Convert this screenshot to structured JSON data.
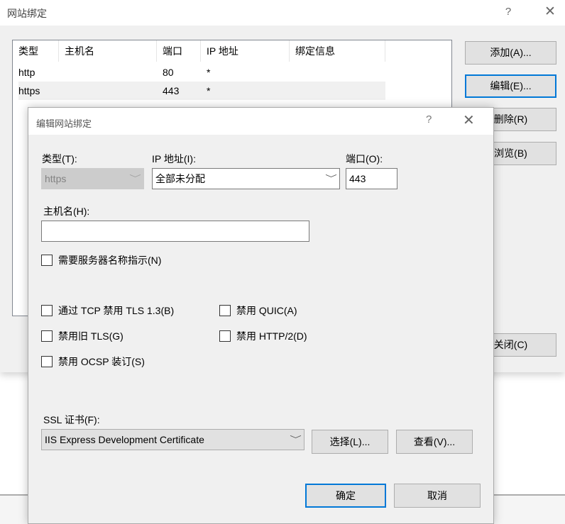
{
  "parent_window": {
    "title": "网站绑定",
    "help_glyph": "?",
    "close_glyph": "✕",
    "list": {
      "columns": [
        "类型",
        "主机名",
        "端口",
        "IP 地址",
        "绑定信息"
      ],
      "rows": [
        {
          "type": "http",
          "host": "",
          "port": "80",
          "ip": "*",
          "info": ""
        },
        {
          "type": "https",
          "host": "",
          "port": "443",
          "ip": "*",
          "info": ""
        }
      ],
      "selected_row": 1
    },
    "buttons": {
      "add": "添加(A)...",
      "edit": "编辑(E)...",
      "remove": "删除(R)",
      "browse": "浏览(B)",
      "close": "关闭(C)"
    }
  },
  "dialog": {
    "title": "编辑网站绑定",
    "help_glyph": "?",
    "close_glyph": "✕",
    "type_label": "类型(T):",
    "type_value": "https",
    "ip_label": "IP 地址(I):",
    "ip_value": "全部未分配",
    "port_label": "端口(O):",
    "port_value": "443",
    "host_label": "主机名(H):",
    "host_value": "",
    "checkboxes": {
      "sni": {
        "label": "需要服务器名称指示(N)",
        "checked": false
      },
      "disable_tls13_tcp": {
        "label": "通过 TCP 禁用 TLS 1.3(B)",
        "checked": false
      },
      "disable_quic": {
        "label": "禁用 QUIC(A)",
        "checked": false
      },
      "disable_legacy_tls": {
        "label": "禁用旧 TLS(G)",
        "checked": false
      },
      "disable_http2": {
        "label": "禁用 HTTP/2(D)",
        "checked": false
      },
      "disable_ocsp": {
        "label": "禁用 OCSP 装订(S)",
        "checked": false
      }
    },
    "ssl_label": "SSL 证书(F):",
    "ssl_value": "IIS Express Development Certificate",
    "select_button": "选择(L)...",
    "view_button": "查看(V)...",
    "ok_button": "确定",
    "cancel_button": "取消"
  },
  "icons": {
    "dropdown_arrow": "﹀"
  }
}
